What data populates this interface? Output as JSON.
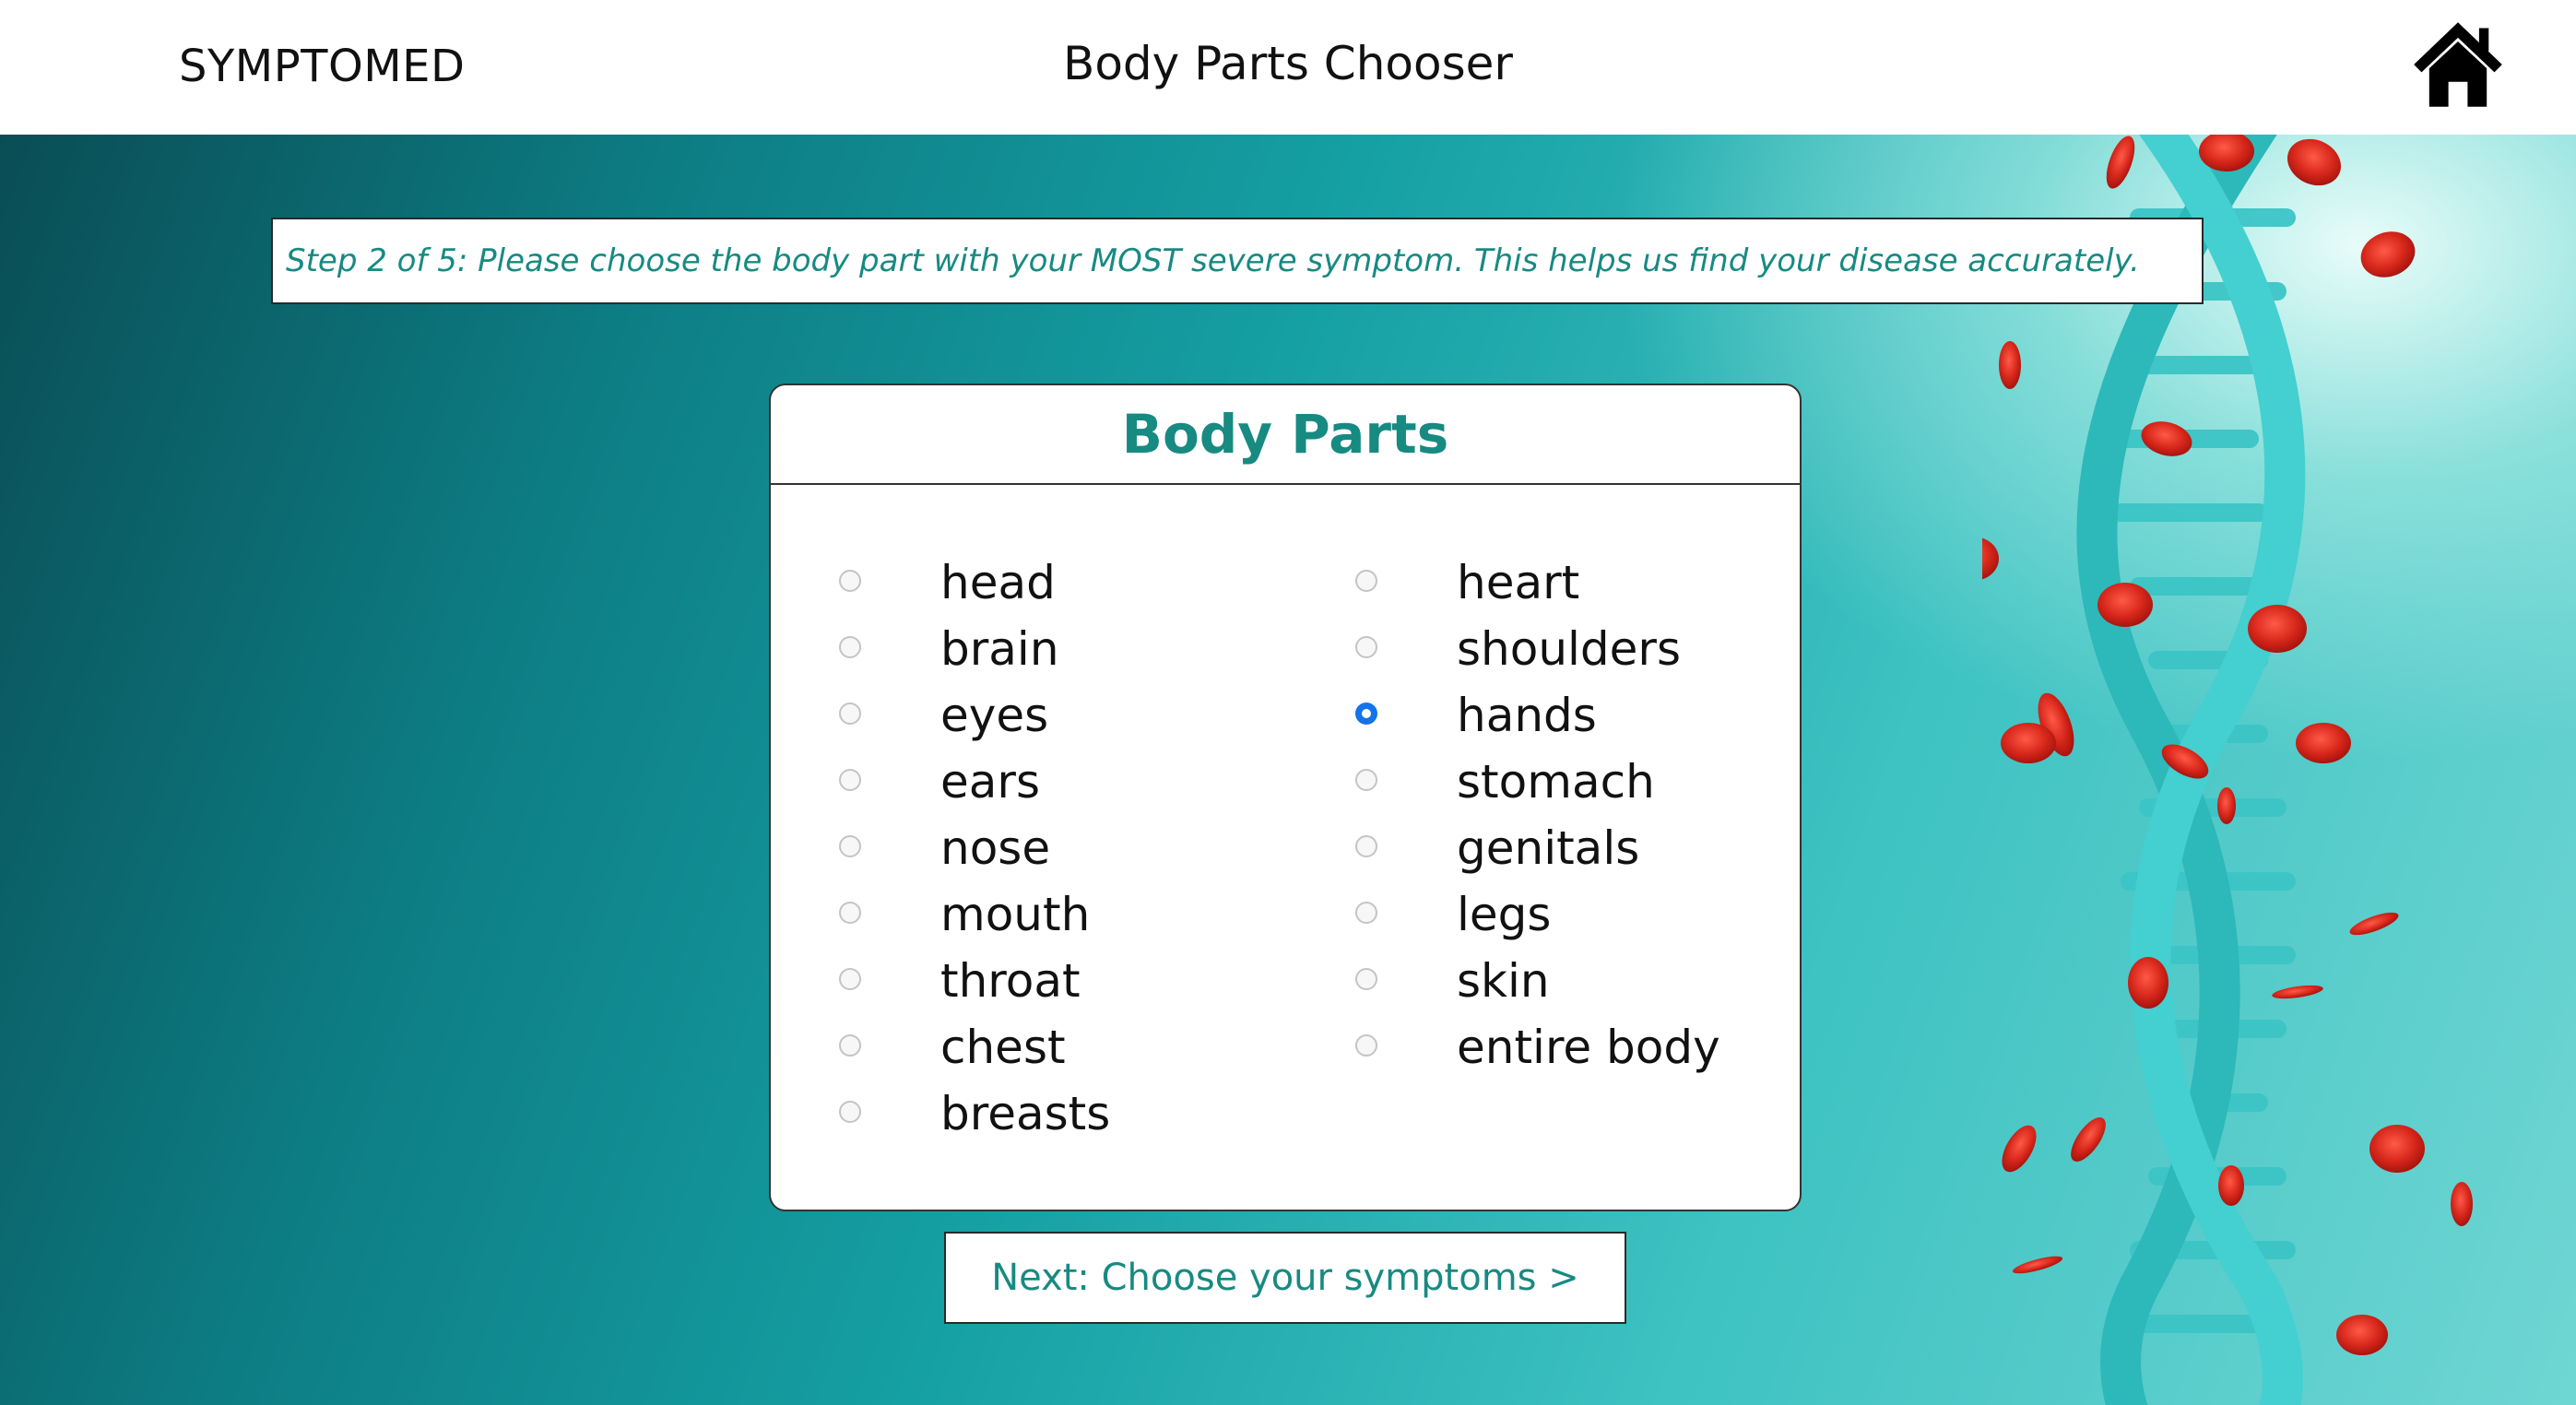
{
  "header": {
    "brand": "SYMPTOMED",
    "title": "Body Parts Chooser",
    "home_icon": "home-icon"
  },
  "instructions": "Step 2 of 5: Please choose the body part with your MOST severe symptom. This helps us find your disease accurately.",
  "panel": {
    "title": "Body Parts",
    "selected": "hands",
    "left_column": [
      "head",
      "brain",
      "eyes",
      "ears",
      "nose",
      "mouth",
      "throat",
      "chest",
      "breasts"
    ],
    "right_column": [
      "heart",
      "shoulders",
      "hands",
      "stomach",
      "genitals",
      "legs",
      "skin",
      "entire body"
    ]
  },
  "next_button": "Next: Choose your symptoms >",
  "colors": {
    "accent": "#178a82",
    "radio_selected": "#1274e8",
    "background_dark": "#0a4d55",
    "background_light": "#6fd6d3"
  }
}
